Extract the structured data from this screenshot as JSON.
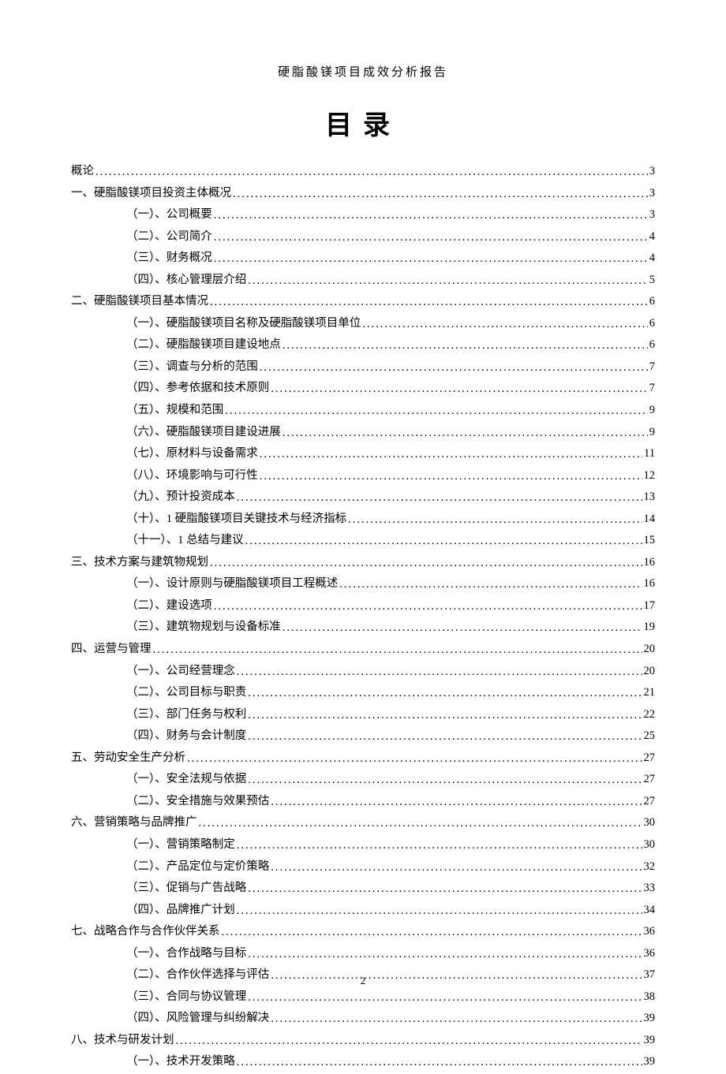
{
  "header": "硬脂酸镁项目成效分析报告",
  "title": "目录",
  "pageNumber": "2",
  "toc": [
    {
      "level": 1,
      "title": "概论",
      "page": "3"
    },
    {
      "level": 1,
      "title": "一、硬脂酸镁项目投资主体概况",
      "page": "3"
    },
    {
      "level": 2,
      "title": "（一）、公司概要",
      "page": "3"
    },
    {
      "level": 2,
      "title": "（二）、公司简介",
      "page": "4"
    },
    {
      "level": 2,
      "title": "（三）、财务概况",
      "page": "4"
    },
    {
      "level": 2,
      "title": "（四）、核心管理层介绍",
      "page": "5"
    },
    {
      "level": 1,
      "title": "二、硬脂酸镁项目基本情况",
      "page": "6"
    },
    {
      "level": 2,
      "title": "（一）、硬脂酸镁项目名称及硬脂酸镁项目单位",
      "page": "6"
    },
    {
      "level": 2,
      "title": "（二）、硬脂酸镁项目建设地点",
      "page": "6"
    },
    {
      "level": 2,
      "title": "（三）、调查与分析的范围",
      "page": "7"
    },
    {
      "level": 2,
      "title": "（四）、参考依据和技术原则",
      "page": "7"
    },
    {
      "level": 2,
      "title": "（五）、规模和范围",
      "page": "9"
    },
    {
      "level": 2,
      "title": "（六）、硬脂酸镁项目建设进展",
      "page": "9"
    },
    {
      "level": 2,
      "title": "（七）、原材料与设备需求",
      "page": "11"
    },
    {
      "level": 2,
      "title": "（八）、环境影响与可行性",
      "page": "12"
    },
    {
      "level": 2,
      "title": "（九）、预计投资成本",
      "page": "13"
    },
    {
      "level": 2,
      "title": "（十）、1 硬脂酸镁项目关键技术与经济指标",
      "page": "14"
    },
    {
      "level": 2,
      "title": "（十一）、1 总结与建议",
      "page": "15"
    },
    {
      "level": 1,
      "title": "三、技术方案与建筑物规划",
      "page": "16"
    },
    {
      "level": 2,
      "title": "（一）、设计原则与硬脂酸镁项目工程概述",
      "page": "16"
    },
    {
      "level": 2,
      "title": "（二）、建设选项",
      "page": "17"
    },
    {
      "level": 2,
      "title": "（三）、建筑物规划与设备标准",
      "page": "19"
    },
    {
      "level": 1,
      "title": "四、运营与管理",
      "page": "20"
    },
    {
      "level": 2,
      "title": "（一）、公司经营理念",
      "page": "20"
    },
    {
      "level": 2,
      "title": "（二）、公司目标与职责",
      "page": "21"
    },
    {
      "level": 2,
      "title": "（三）、部门任务与权利",
      "page": "22"
    },
    {
      "level": 2,
      "title": "（四）、财务与会计制度",
      "page": "25"
    },
    {
      "level": 1,
      "title": "五、劳动安全生产分析",
      "page": "27"
    },
    {
      "level": 2,
      "title": "（一）、安全法规与依据",
      "page": "27"
    },
    {
      "level": 2,
      "title": "（二）、安全措施与效果预估",
      "page": "27"
    },
    {
      "level": 1,
      "title": "六、营销策略与品牌推广",
      "page": "30"
    },
    {
      "level": 2,
      "title": "（一）、营销策略制定",
      "page": "30"
    },
    {
      "level": 2,
      "title": "（二）、产品定位与定价策略",
      "page": "32"
    },
    {
      "level": 2,
      "title": "（三）、促销与广告战略",
      "page": "33"
    },
    {
      "level": 2,
      "title": "（四）、品牌推广计划",
      "page": "34"
    },
    {
      "level": 1,
      "title": "七、战略合作与合作伙伴关系",
      "page": "36"
    },
    {
      "level": 2,
      "title": "（一）、合作战略与目标",
      "page": "36"
    },
    {
      "level": 2,
      "title": "（二）、合作伙伴选择与评估",
      "page": "37"
    },
    {
      "level": 2,
      "title": "（三）、合同与协议管理",
      "page": "38"
    },
    {
      "level": 2,
      "title": "（四）、风险管理与纠纷解决",
      "page": "39"
    },
    {
      "level": 1,
      "title": "八、技术与研发计划",
      "page": "39"
    },
    {
      "level": 2,
      "title": "（一）、技术开发策略",
      "page": "39"
    }
  ]
}
